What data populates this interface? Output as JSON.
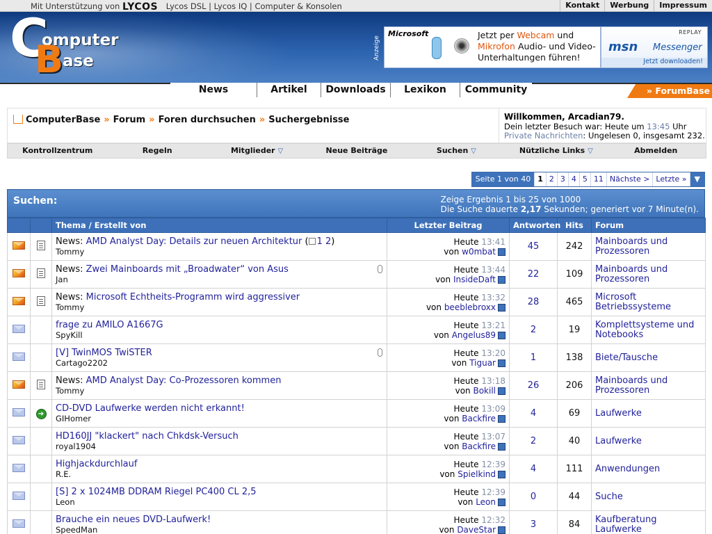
{
  "topbar": {
    "sponsor_prefix": "Mit Unterstützung von",
    "sponsor_brand": "LYCOS",
    "sponsor_links": "Lycos DSL | Lycos IQ | Computer & Konsolen",
    "links": [
      "Kontakt",
      "Werbung",
      "Impressum"
    ]
  },
  "logo": {
    "c": "C",
    "omputer": "omputer",
    "b": "B",
    "ase": "ase"
  },
  "ad": {
    "label": "Anzeige",
    "microsoft": "Microsoft",
    "line1_a": "Jetzt per ",
    "line1_b": "Webcam",
    "line1_c": " und",
    "line2_a": "Mikrofon",
    "line2_b": " Audio- und Video-",
    "line3": "Unterhaltungen führen!",
    "replay": "REPLAY",
    "msn": "msn",
    "messenger": "Messenger",
    "download": "Jetzt downloaden!"
  },
  "nav": {
    "tabs": [
      "News",
      "Artikel",
      "Downloads",
      "Lexikon",
      "Community"
    ],
    "forumbase": "» ForumBase"
  },
  "breadcrumb": {
    "items": [
      "ComputerBase",
      "Forum",
      "Foren durchsuchen",
      "Suchergebnisse"
    ],
    "sep": "»"
  },
  "welcome": {
    "title": "Willkommen, Arcadian79.",
    "last_visit_prefix": "Dein letzter Besuch war: Heute um ",
    "last_visit_time": "13:45",
    "last_visit_suffix": " Uhr",
    "pm_label": "Private Nachrichten",
    "pm_text": ": Ungelesen 0, insgesamt 232."
  },
  "subnav": [
    "Kontrollzentrum",
    "Regeln",
    "Mitglieder",
    "Neue Beiträge",
    "Suchen",
    "Nützliche Links",
    "Abmelden"
  ],
  "pager": {
    "label": "Seite 1 von 40",
    "pages": [
      "1",
      "2",
      "3",
      "4",
      "5",
      "11"
    ],
    "next": "Nächste >",
    "last": "Letzte »"
  },
  "search": {
    "title": "Suchen:",
    "info1": "Zeige Ergebnis 1 bis 25 von 1000",
    "info2_a": "Die Suche dauerte ",
    "info2_b": "2,17",
    "info2_c": " Sekunden; generiert vor 7 Minute(n)."
  },
  "table": {
    "headers": [
      "Thema / Erstellt von",
      "Letzter Beitrag",
      "Antworten",
      "Hits",
      "Forum"
    ],
    "rows": [
      {
        "status": "hot",
        "icon": "doc",
        "prefix": "News: ",
        "title": "AMD Analyst Day: Details zur neuen Architektur",
        "pages": "1 2",
        "author": "Tommy",
        "day": "Heute",
        "time": "13:41",
        "by": "w0mbat",
        "replies": "45",
        "hits": "242",
        "forum": "Mainboards und Prozessoren",
        "attach": false
      },
      {
        "status": "hot",
        "icon": "doc",
        "prefix": "News: ",
        "title": "Zwei Mainboards mit „Broadwater“ von Asus",
        "pages": "",
        "author": "Jan",
        "day": "Heute",
        "time": "13:44",
        "by": "InsideDaft",
        "replies": "22",
        "hits": "109",
        "forum": "Mainboards und Prozessoren",
        "attach": true
      },
      {
        "status": "hot",
        "icon": "doc",
        "prefix": "News: ",
        "title": "Microsoft Echtheits-Programm wird aggressiver",
        "pages": "",
        "author": "Tommy",
        "day": "Heute",
        "time": "13:32",
        "by": "beeblebroxx",
        "replies": "28",
        "hits": "465",
        "forum": "Microsoft Betriebssysteme",
        "attach": false
      },
      {
        "status": "cold",
        "icon": "",
        "prefix": "",
        "title": "frage zu AMILO A1667G",
        "pages": "",
        "author": "SpyKill",
        "day": "Heute",
        "time": "13:21",
        "by": "Angelus89",
        "replies": "2",
        "hits": "19",
        "forum": "Komplettsysteme und Notebooks",
        "attach": false
      },
      {
        "status": "cold",
        "icon": "",
        "prefix": "",
        "title": "[V] TwinMOS TwiSTER",
        "pages": "",
        "author": "Cartago2202",
        "day": "Heute",
        "time": "13:20",
        "by": "Tiguar",
        "replies": "1",
        "hits": "138",
        "forum": "Biete/Tausche",
        "attach": true
      },
      {
        "status": "hot",
        "icon": "doc",
        "prefix": "News: ",
        "title": "AMD Analyst Day: Co-Prozessoren kommen",
        "pages": "",
        "author": "Tommy",
        "day": "Heute",
        "time": "13:18",
        "by": "Bokill",
        "replies": "26",
        "hits": "206",
        "forum": "Mainboards und Prozessoren",
        "attach": false
      },
      {
        "status": "cold",
        "icon": "arrow",
        "prefix": "",
        "title": "CD-DVD Laufwerke werden nicht erkannt!",
        "pages": "",
        "author": "GIHomer",
        "day": "Heute",
        "time": "13:09",
        "by": "Backfire",
        "replies": "4",
        "hits": "69",
        "forum": "Laufwerke",
        "attach": false
      },
      {
        "status": "cold",
        "icon": "",
        "prefix": "",
        "title": "HD160JJ \"klackert\" nach Chkdsk-Versuch",
        "pages": "",
        "author": "royal1904",
        "day": "Heute",
        "time": "13:07",
        "by": "Backfire",
        "replies": "2",
        "hits": "40",
        "forum": "Laufwerke",
        "attach": false
      },
      {
        "status": "cold",
        "icon": "",
        "prefix": "",
        "title": "Highjackdurchlauf",
        "pages": "",
        "author": "R.E.",
        "day": "Heute",
        "time": "12:39",
        "by": "Spielkind",
        "replies": "4",
        "hits": "111",
        "forum": "Anwendungen",
        "attach": false
      },
      {
        "status": "cold",
        "icon": "",
        "prefix": "",
        "title": "[S] 2 x 1024MB DDRAM Riegel PC400 CL 2,5",
        "pages": "",
        "author": "Leon",
        "day": "Heute",
        "time": "12:39",
        "by": "Leon",
        "replies": "0",
        "hits": "44",
        "forum": "Suche",
        "attach": false
      },
      {
        "status": "cold",
        "icon": "",
        "prefix": "",
        "title": "Brauche ein neues DVD-Laufwerk!",
        "pages": "",
        "author": "SpeedMan",
        "day": "Heute",
        "time": "12:32",
        "by": "DaveStar",
        "replies": "3",
        "hits": "84",
        "forum": "Kaufberatung Laufwerke",
        "attach": false
      }
    ]
  }
}
